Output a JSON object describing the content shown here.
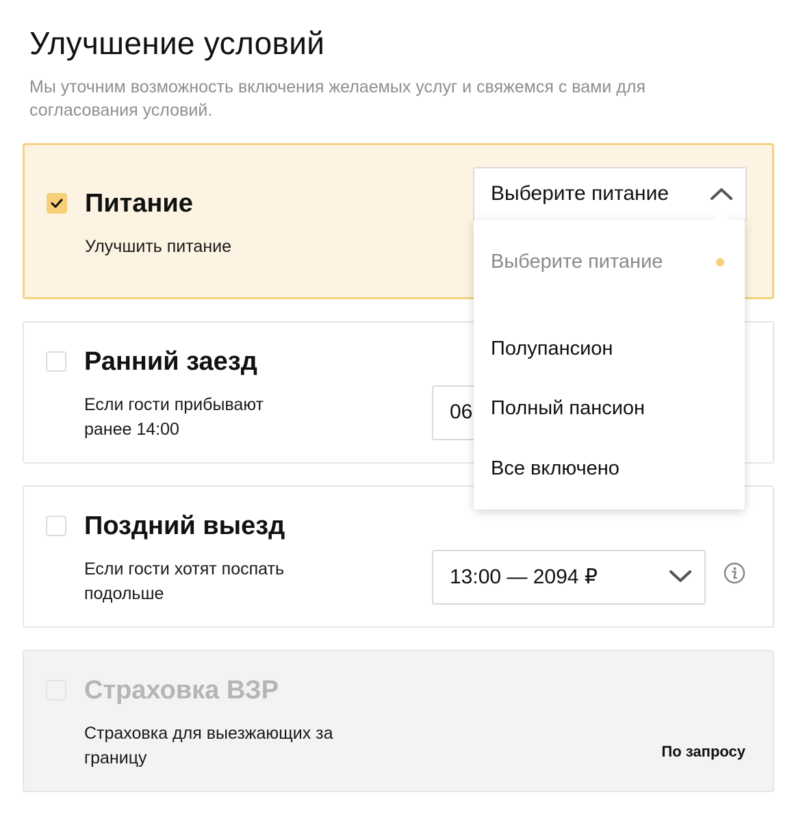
{
  "page": {
    "title": "Улучшение условий",
    "subtitle": "Мы уточним возможность включения желаемых услуг и свяжемся с вами для согласования условий."
  },
  "meal": {
    "title": "Питание",
    "description": "Улучшить питание",
    "checked": true,
    "select_value": "Выберите питание",
    "options": [
      "Выберите питание",
      "Полупансион",
      "Полный пансион",
      "Все включено"
    ]
  },
  "early_checkin": {
    "title": "Ранний заезд",
    "description": "Если гости прибывают ранее 14:00",
    "select_value": "06"
  },
  "late_checkout": {
    "title": "Поздний выезд",
    "description": "Если гости хотят поспать подольше",
    "select_value": "13:00 — 2094 ₽"
  },
  "insurance": {
    "title": "Страховка ВЗР",
    "description": "Страховка для выезжающих за границу",
    "price": "По запросу"
  },
  "colors": {
    "accent": "#f6cf78",
    "selected_bg": "#fdf3e2",
    "selected_border": "#f5d27e",
    "disabled_bg": "#f3f3f3"
  }
}
